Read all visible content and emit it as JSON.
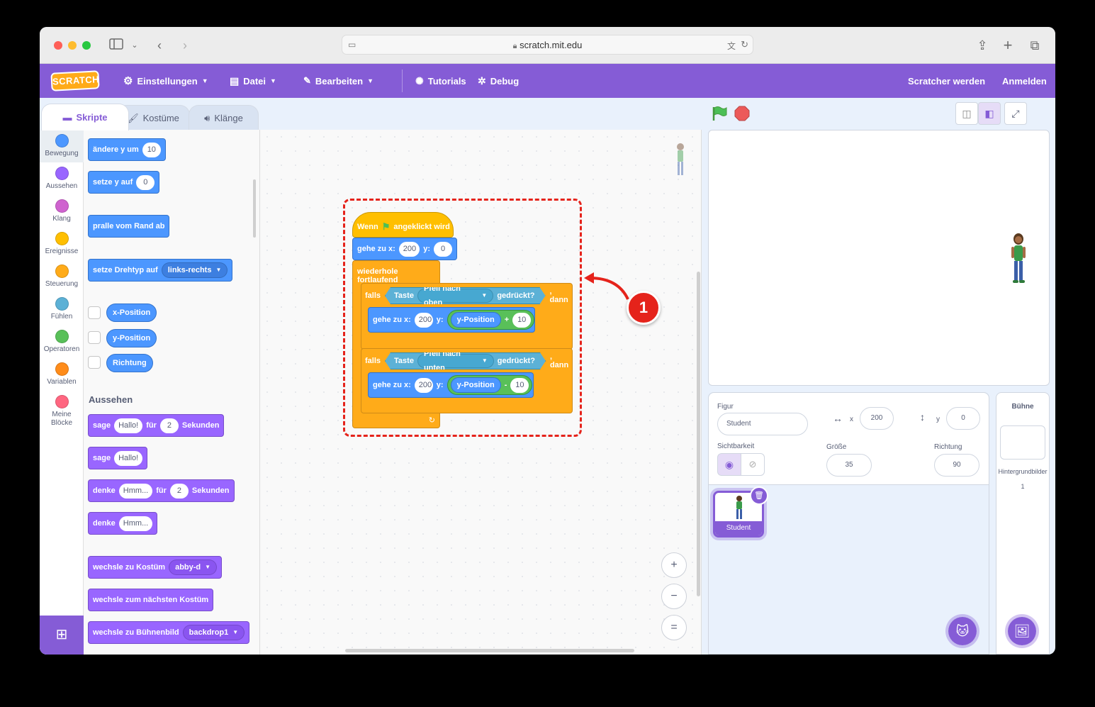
{
  "browser": {
    "url": "scratch.mit.edu"
  },
  "menubar": {
    "logo": "SCRATCH",
    "settings": "Einstellungen",
    "file": "Datei",
    "edit": "Bearbeiten",
    "tutorials": "Tutorials",
    "debug": "Debug",
    "join": "Scratcher werden",
    "signin": "Anmelden"
  },
  "tabs": {
    "code": "Skripte",
    "costumes": "Kostüme",
    "sounds": "Klänge"
  },
  "categories": [
    {
      "label": "Bewegung",
      "color": "#4c97ff"
    },
    {
      "label": "Aussehen",
      "color": "#9966ff"
    },
    {
      "label": "Klang",
      "color": "#cf63cf"
    },
    {
      "label": "Ereignisse",
      "color": "#ffbf00"
    },
    {
      "label": "Steuerung",
      "color": "#ffab19"
    },
    {
      "label": "Fühlen",
      "color": "#5cb1d6"
    },
    {
      "label": "Operatoren",
      "color": "#59c059"
    },
    {
      "label": "Variablen",
      "color": "#ff8c1a"
    },
    {
      "label": "Meine Blöcke",
      "color": "#ff6680"
    }
  ],
  "palette": {
    "change_y": {
      "label": "ändere y um",
      "value": "10"
    },
    "set_y": {
      "label": "setze y auf",
      "value": "0"
    },
    "bounce": "pralle vom Rand ab",
    "rotation": {
      "label": "setze Drehtyp auf",
      "option": "links-rechts"
    },
    "xpos": "x-Position",
    "ypos": "y-Position",
    "direction": "Richtung",
    "looks_title": "Aussehen",
    "say_for": {
      "label": "sage",
      "text": "Hallo!",
      "for": "für",
      "secs": "2",
      "unit": "Sekunden"
    },
    "say": {
      "label": "sage",
      "text": "Hallo!"
    },
    "think_for": {
      "label": "denke",
      "text": "Hmm...",
      "for": "für",
      "secs": "2",
      "unit": "Sekunden"
    },
    "think": {
      "label": "denke",
      "text": "Hmm..."
    },
    "switch_costume": {
      "label": "wechsle zu Kostüm",
      "option": "abby-d"
    },
    "next_costume": "wechsle zum nächsten Kostüm",
    "switch_backdrop": {
      "label": "wechsle zu Bühnenbild",
      "option": "backdrop1"
    }
  },
  "script": {
    "hat": {
      "pre": "Wenn",
      "post": "angeklickt wird"
    },
    "goto1": {
      "label": "gehe zu x:",
      "x": "200",
      "ylabel": "y:",
      "y": "0"
    },
    "forever": "wiederhole fortlaufend",
    "if1": {
      "if": "falls",
      "key": "Taste",
      "option": "Pfeil nach oben",
      "pressed": "gedrückt?",
      "then": ", dann"
    },
    "goto2": {
      "label": "gehe zu x:",
      "x": "200",
      "ylabel": "y:",
      "reporter": "y-Position",
      "op": "+",
      "val": "10"
    },
    "if2": {
      "if": "falls",
      "key": "Taste",
      "option": "Pfeil nach unten",
      "pressed": "gedrückt?",
      "then": ", dann"
    },
    "goto3": {
      "label": "gehe zu x:",
      "x": "200",
      "ylabel": "y:",
      "reporter": "y-Position",
      "op": "-",
      "val": "10"
    },
    "callout": "1"
  },
  "zoom": {
    "in": "+",
    "out": "−",
    "reset": "="
  },
  "sprite_info": {
    "sprite_label": "Figur",
    "sprite_name": "Student",
    "x_label": "x",
    "x": "200",
    "y_label": "y",
    "y": "0",
    "show_label": "Sichtbarkeit",
    "size_label": "Größe",
    "size": "35",
    "direction_label": "Richtung",
    "direction": "90"
  },
  "sprites": [
    {
      "name": "Student"
    }
  ],
  "stage_pane": {
    "title": "Bühne",
    "backdrops_label": "Hintergrundbilder",
    "backdrops_count": "1"
  }
}
